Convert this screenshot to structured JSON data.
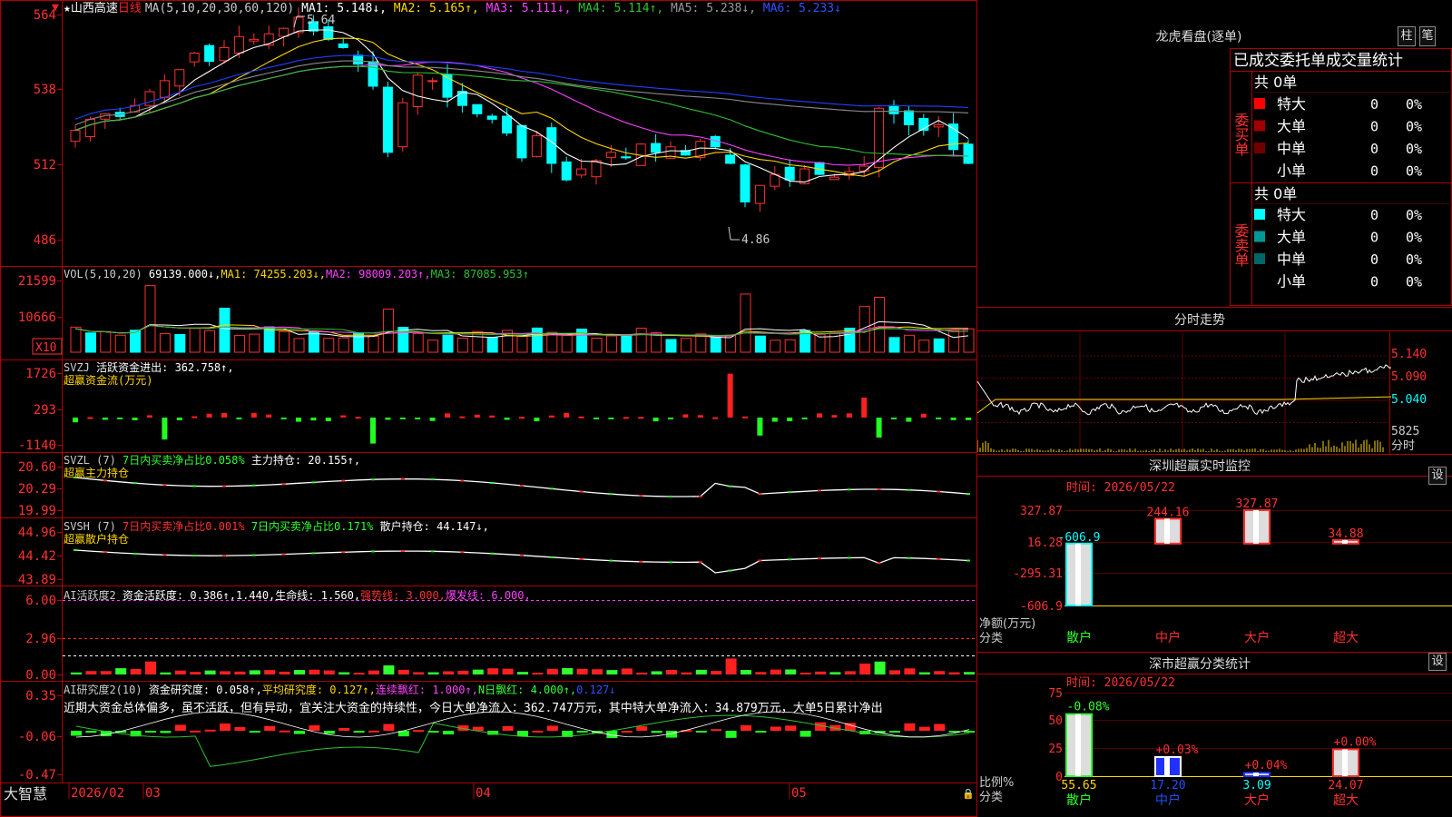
{
  "colors": {
    "up": "#ff3030",
    "down": "#00ffff",
    "ma1": "#ffffff",
    "ma2": "#ffd700",
    "ma3": "#ff40ff",
    "ma4": "#30c030",
    "ma5": "#8a8a8a",
    "ma6": "#2040ff",
    "grid": "#b00000",
    "accent_red": "#ff2020"
  },
  "header": {
    "star": "★",
    "stock_name": "山西高速",
    "period": "日线",
    "ma_prefix": "MA(5,10,20,30,60,120)",
    "ma_items": [
      {
        "text": "MA1: 5.148↓,",
        "color": "#ffffff"
      },
      {
        "text": "MA2: 5.165↑,",
        "color": "#ffd700"
      },
      {
        "text": "MA3: 5.111↓,",
        "color": "#ff40ff"
      },
      {
        "text": "MA4: 5.114↑,",
        "color": "#30c030"
      },
      {
        "text": "MA5: 5.238↓,",
        "color": "#9a9a9a"
      },
      {
        "text": "MA6: 5.233↓",
        "color": "#3050ff"
      }
    ]
  },
  "axes": {
    "price_ticks": [
      "564",
      "538",
      "512",
      "486"
    ],
    "vol_ticks": [
      "21599",
      "10666",
      "X10"
    ],
    "svzj_ticks": [
      "1726",
      "293",
      "-1140"
    ],
    "svzl_ticks": [
      "20.60",
      "20.29",
      "19.99"
    ],
    "svsh_ticks": [
      "44.96",
      "44.42",
      "43.89"
    ],
    "ai1_ticks": [
      "6.00",
      "2.96",
      "0.00"
    ],
    "ai2_ticks": [
      "0.35",
      "-0.06",
      "-0.47"
    ]
  },
  "price_annotations": {
    "high": "5.64",
    "low": "4.86"
  },
  "indicators": {
    "vol": [
      {
        "text": "VOL(5,10,20) ",
        "color": "#cccccc"
      },
      {
        "text": "69139.000↓,",
        "color": "#ffffff"
      },
      {
        "text": "MA1: 74255.203↓,",
        "color": "#ffd700"
      },
      {
        "text": "MA2: 98009.203↑,",
        "color": "#ff40ff"
      },
      {
        "text": "MA3: 87085.953↑",
        "color": "#30c030"
      }
    ],
    "svzj_line1": [
      {
        "text": "SVZJ  ",
        "color": "#cccccc"
      },
      {
        "text": "活跃资金进出: 362.758↑,",
        "color": "#ffffff"
      }
    ],
    "svzj_line2": "超赢资金流(万元)",
    "svzl_line1": [
      {
        "text": "SVZL (7) ",
        "color": "#cccccc"
      },
      {
        "text": "7日内买卖净占比0.058%",
        "color": "#30ff30"
      },
      {
        "text": " 主力持仓: 20.155↑,",
        "color": "#ffffff"
      }
    ],
    "svzl_line2": "超赢主力持仓",
    "svsh_line1": [
      {
        "text": "SVSH (7) ",
        "color": "#cccccc"
      },
      {
        "text": "7日内买卖净占比0.001%",
        "color": "#ff3030"
      },
      {
        "text": " 7日内买卖净占比0.171%",
        "color": "#30ff30"
      },
      {
        "text": " 散户持仓: 44.147↓,",
        "color": "#ffffff"
      }
    ],
    "svsh_line2": "超赢散户持仓",
    "ai1": [
      {
        "text": "AI活跃度2 ",
        "color": "#cccccc"
      },
      {
        "text": "资金活跃度: 0.386↑,",
        "color": "#ffffff"
      },
      {
        "text": "1.440,",
        "color": "#ffffff"
      },
      {
        "text": "生命线: 1.560,",
        "color": "#ffffff"
      },
      {
        "text": "强势线: 3.000,",
        "color": "#ff3030"
      },
      {
        "text": "爆发线: 6.000,",
        "color": "#ff40ff"
      }
    ],
    "ai2": [
      {
        "text": "AI研究度2(10) ",
        "color": "#cccccc"
      },
      {
        "text": "资金研究度: 0.058↑,",
        "color": "#ffffff"
      },
      {
        "text": "平均研究度: 0.127↑,",
        "color": "#ffd700"
      },
      {
        "text": "连续飘红: 1.000↑,",
        "color": "#ff40ff"
      },
      {
        "text": "N日飘红: 4.000↑,",
        "color": "#30ff30"
      },
      {
        "text": "0.127↓",
        "color": "#3050ff"
      }
    ],
    "ai2_comment": "近期大资金总体偏多，虽不活跃，但有异动，宜关注大资金的持续性，今日大单净流入：362.747万元，其中特大单净流入：34.879万元，大单5日累计净出"
  },
  "bottom_axis": {
    "brand": "大智慧",
    "labels": [
      "2026/02",
      "03",
      "04",
      "05"
    ]
  },
  "right_panel": {
    "longhu": {
      "title": "龙虎看盘(逐单)",
      "btn1": "柱",
      "btn2": "笔"
    },
    "stats": {
      "header": "已成交委托单成交量统计",
      "buy_side": "委买单",
      "buy_count": "共 0单",
      "sell_side": "委卖单",
      "sell_count": "共 0单",
      "buy_rows": [
        {
          "label": "特大",
          "value": "0",
          "pct": "0%",
          "color": "#ff0000"
        },
        {
          "label": "大单",
          "value": "0",
          "pct": "0%",
          "color": "#a00000"
        },
        {
          "label": "中单",
          "value": "0",
          "pct": "0%",
          "color": "#700000"
        },
        {
          "label": "小单",
          "value": "0",
          "pct": "0%",
          "color": "#000000"
        }
      ],
      "sell_rows": [
        {
          "label": "特大",
          "value": "0",
          "pct": "0%",
          "color": "#00ffff"
        },
        {
          "label": "大单",
          "value": "0",
          "pct": "0%",
          "color": "#009999"
        },
        {
          "label": "中单",
          "value": "0",
          "pct": "0%",
          "color": "#006666"
        },
        {
          "label": "小单",
          "value": "0",
          "pct": "0%",
          "color": "#000000"
        }
      ]
    },
    "intraday": {
      "title": "分时走势",
      "ticks": [
        "5.140",
        "5.090",
        "5.040",
        "5825",
        "分时"
      ]
    },
    "monitor": {
      "title": "深圳超赢实时监控",
      "set_btn": "设",
      "time_label": "时间: 2026/05/22",
      "y_ticks": [
        "327.87",
        "16.28",
        "-295.31",
        "-606.9"
      ],
      "y_label": "净额(万元)",
      "x_label": "分类"
    },
    "classify": {
      "title": "深市超赢分类统计",
      "set_btn": "设",
      "time_label": "时间: 2026/05/22",
      "y_ticks": [
        "75",
        "50",
        "25",
        "0"
      ],
      "y_label": "比例%",
      "x_label": "分类"
    }
  },
  "chart_data": [
    {
      "type": "bar",
      "title": "深圳超赢实时监控",
      "ylabel": "净额(万元)",
      "xlabel": "分类",
      "categories": [
        "散户",
        "中户",
        "大户",
        "超大"
      ],
      "values": [
        -606.9,
        244.16,
        327.87,
        34.88
      ],
      "labels": [
        "-606.9",
        "244.16",
        "327.87",
        "34.88"
      ],
      "ylim": [
        -606.9,
        327.87
      ]
    },
    {
      "type": "bar",
      "title": "深市超赢分类统计",
      "ylabel": "比例%",
      "xlabel": "分类",
      "categories": [
        "散户",
        "中户",
        "大户",
        "超大"
      ],
      "values": [
        55.65,
        17.2,
        3.09,
        24.07
      ],
      "change_labels": [
        "-0.08%",
        "+0.03%",
        "+0.04%",
        "+0.00%"
      ],
      "value_labels": [
        "55.65",
        "17.20",
        "3.09",
        "24.07"
      ],
      "ylim": [
        0,
        75
      ]
    }
  ]
}
